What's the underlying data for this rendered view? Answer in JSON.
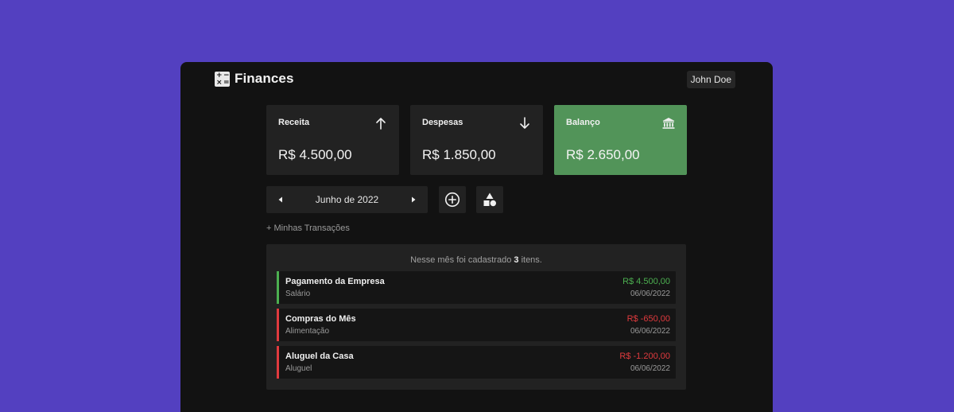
{
  "header": {
    "title": "Finances",
    "user": "John Doe"
  },
  "cards": [
    {
      "label": "Receita",
      "value": "R$ 4.500,00",
      "icon": "arrow-up-icon"
    },
    {
      "label": "Despesas",
      "value": "R$ 1.850,00",
      "icon": "arrow-down-icon"
    },
    {
      "label": "Balanço",
      "value": "R$ 2.650,00",
      "icon": "bank-icon"
    }
  ],
  "nav": {
    "month": "Junho de 2022"
  },
  "link": {
    "my_transactions": "+ Minhas Transações"
  },
  "summary": {
    "prefix": "Nesse mês foi cadastrado",
    "count": "3",
    "suffix": "itens."
  },
  "transactions": [
    {
      "title": "Pagamento da Empresa",
      "category": "Salário",
      "amount": "R$ 4.500,00",
      "date": "06/06/2022",
      "type": "income"
    },
    {
      "title": "Compras do Mês",
      "category": "Alimentação",
      "amount": "R$ -650,00",
      "date": "06/06/2022",
      "type": "expense"
    },
    {
      "title": "Aluguel da Casa",
      "category": "Aluguel",
      "amount": "R$ -1.200,00",
      "date": "06/06/2022",
      "type": "expense"
    }
  ],
  "colors": {
    "background": "#5340c0",
    "panel": "#222222",
    "balance_card": "#529459",
    "income": "#4caf50",
    "expense": "#e03a3e"
  }
}
